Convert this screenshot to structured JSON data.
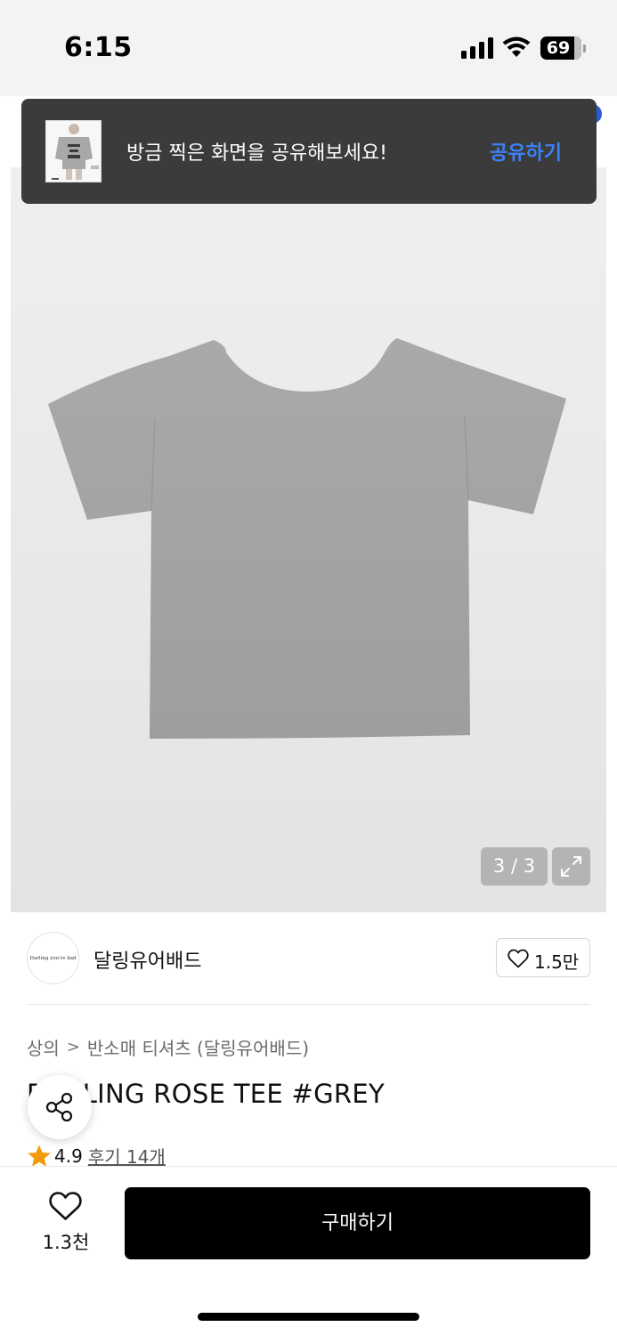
{
  "status_bar": {
    "time": "6:15",
    "battery_percent": "69",
    "battery_level": 0.69
  },
  "share_toast": {
    "message": "방금 찍은 화면을 공유해보세요!",
    "action_label": "공유하기"
  },
  "gallery": {
    "page_counter": "3 / 3",
    "current_page": 3,
    "total_pages": 3
  },
  "brand": {
    "logo_text": "Darling you're bad",
    "name": "달링유어배드",
    "like_count": "1.5만"
  },
  "breadcrumb": {
    "category": "상의",
    "separator": ">",
    "subcategory": "반소매 티셔츠 (달링유어배드)"
  },
  "product": {
    "title": "DARLING ROSE TEE #GREY",
    "rating": "4.9",
    "review_label": "후기 14개"
  },
  "bottom_bar": {
    "wish_count": "1.3천",
    "buy_label": "구매하기"
  },
  "colors": {
    "toast_action": "#3b82f6",
    "star": "#f59a0c",
    "buy_button": "#000000"
  }
}
